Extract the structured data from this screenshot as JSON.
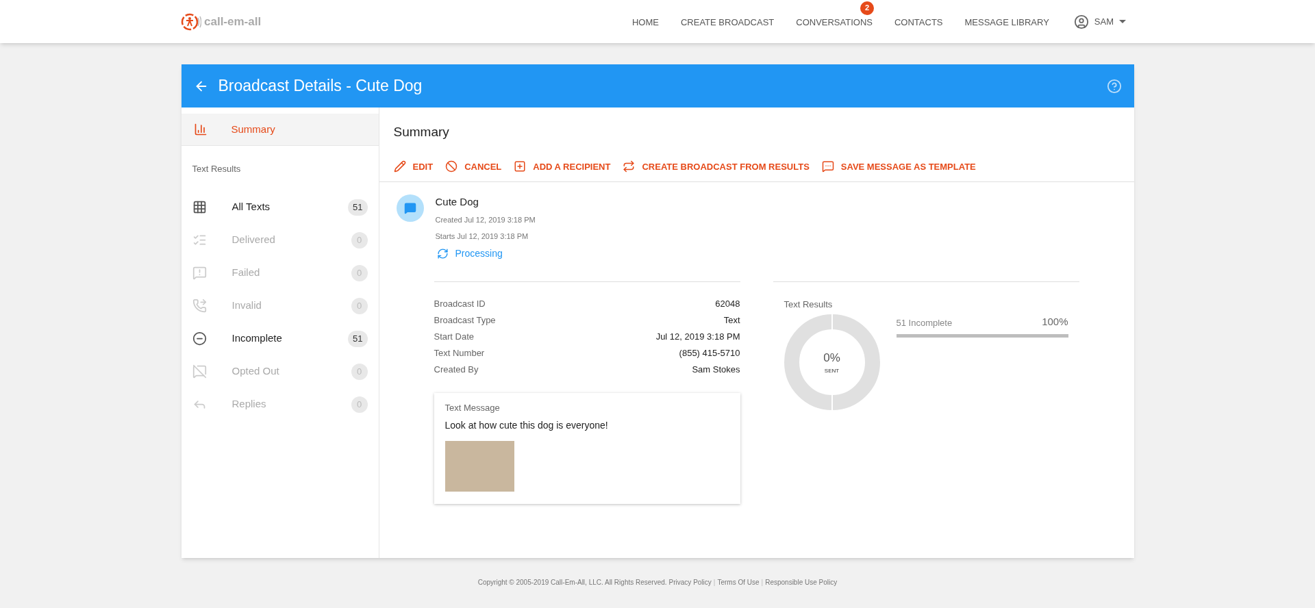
{
  "app": {
    "logo_text": "call-em-all"
  },
  "nav": {
    "items": [
      {
        "label": "HOME"
      },
      {
        "label": "CREATE BROADCAST"
      },
      {
        "label": "CONVERSATIONS",
        "badge": "2"
      },
      {
        "label": "CONTACTS"
      },
      {
        "label": "MESSAGE LIBRARY"
      }
    ],
    "user": "SAM"
  },
  "page": {
    "title": "Broadcast Details - Cute Dog"
  },
  "sidebar": {
    "summary": {
      "label": "Summary",
      "selected": true
    },
    "section_title": "Text Results",
    "items": [
      {
        "label": "All Texts",
        "count": "51",
        "disabled": false
      },
      {
        "label": "Delivered",
        "count": "0",
        "disabled": true
      },
      {
        "label": "Failed",
        "count": "0",
        "disabled": true
      },
      {
        "label": "Invalid",
        "count": "0",
        "disabled": true
      },
      {
        "label": "Incomplete",
        "count": "51",
        "disabled": false
      },
      {
        "label": "Opted Out",
        "count": "0",
        "disabled": true
      },
      {
        "label": "Replies",
        "count": "0",
        "disabled": true
      }
    ]
  },
  "summary": {
    "title": "Summary",
    "actions": [
      "EDIT",
      "CANCEL",
      "ADD A RECIPIENT",
      "CREATE BROADCAST FROM RESULTS",
      "SAVE MESSAGE AS TEMPLATE"
    ],
    "broadcast": {
      "name": "Cute Dog",
      "created": "Created Jul 12, 2019 3:18 PM",
      "starts": "Starts Jul 12, 2019 3:18 PM",
      "status": "Processing"
    },
    "details": [
      {
        "label": "Broadcast ID",
        "value": "62048"
      },
      {
        "label": "Broadcast Type",
        "value": "Text"
      },
      {
        "label": "Start Date",
        "value": "Jul 12, 2019 3:18 PM"
      },
      {
        "label": "Text Number",
        "value": "(855) 415-5710"
      },
      {
        "label": "Created By",
        "value": "Sam Stokes"
      }
    ],
    "message": {
      "title": "Text Message",
      "text": "Look at how cute this dog is everyone!"
    },
    "results": {
      "title": "Text Results",
      "donut_value": "0%",
      "donut_label": "SENT",
      "bars": [
        {
          "label": "51 Incomplete",
          "percent": "100%",
          "level": 1.0
        }
      ]
    }
  },
  "footer": {
    "copyright": "Copyright © 2005-2019 Call-Em-All, LLC. All Rights Reserved.",
    "items": [
      {
        "kind": "link",
        "text": "Privacy Policy"
      },
      {
        "kind": "separator",
        "text": "|"
      },
      {
        "kind": "link",
        "text": "Terms Of Use"
      },
      {
        "kind": "separator",
        "text": "|"
      },
      {
        "kind": "link",
        "text": "Responsible Use Policy"
      }
    ]
  }
}
